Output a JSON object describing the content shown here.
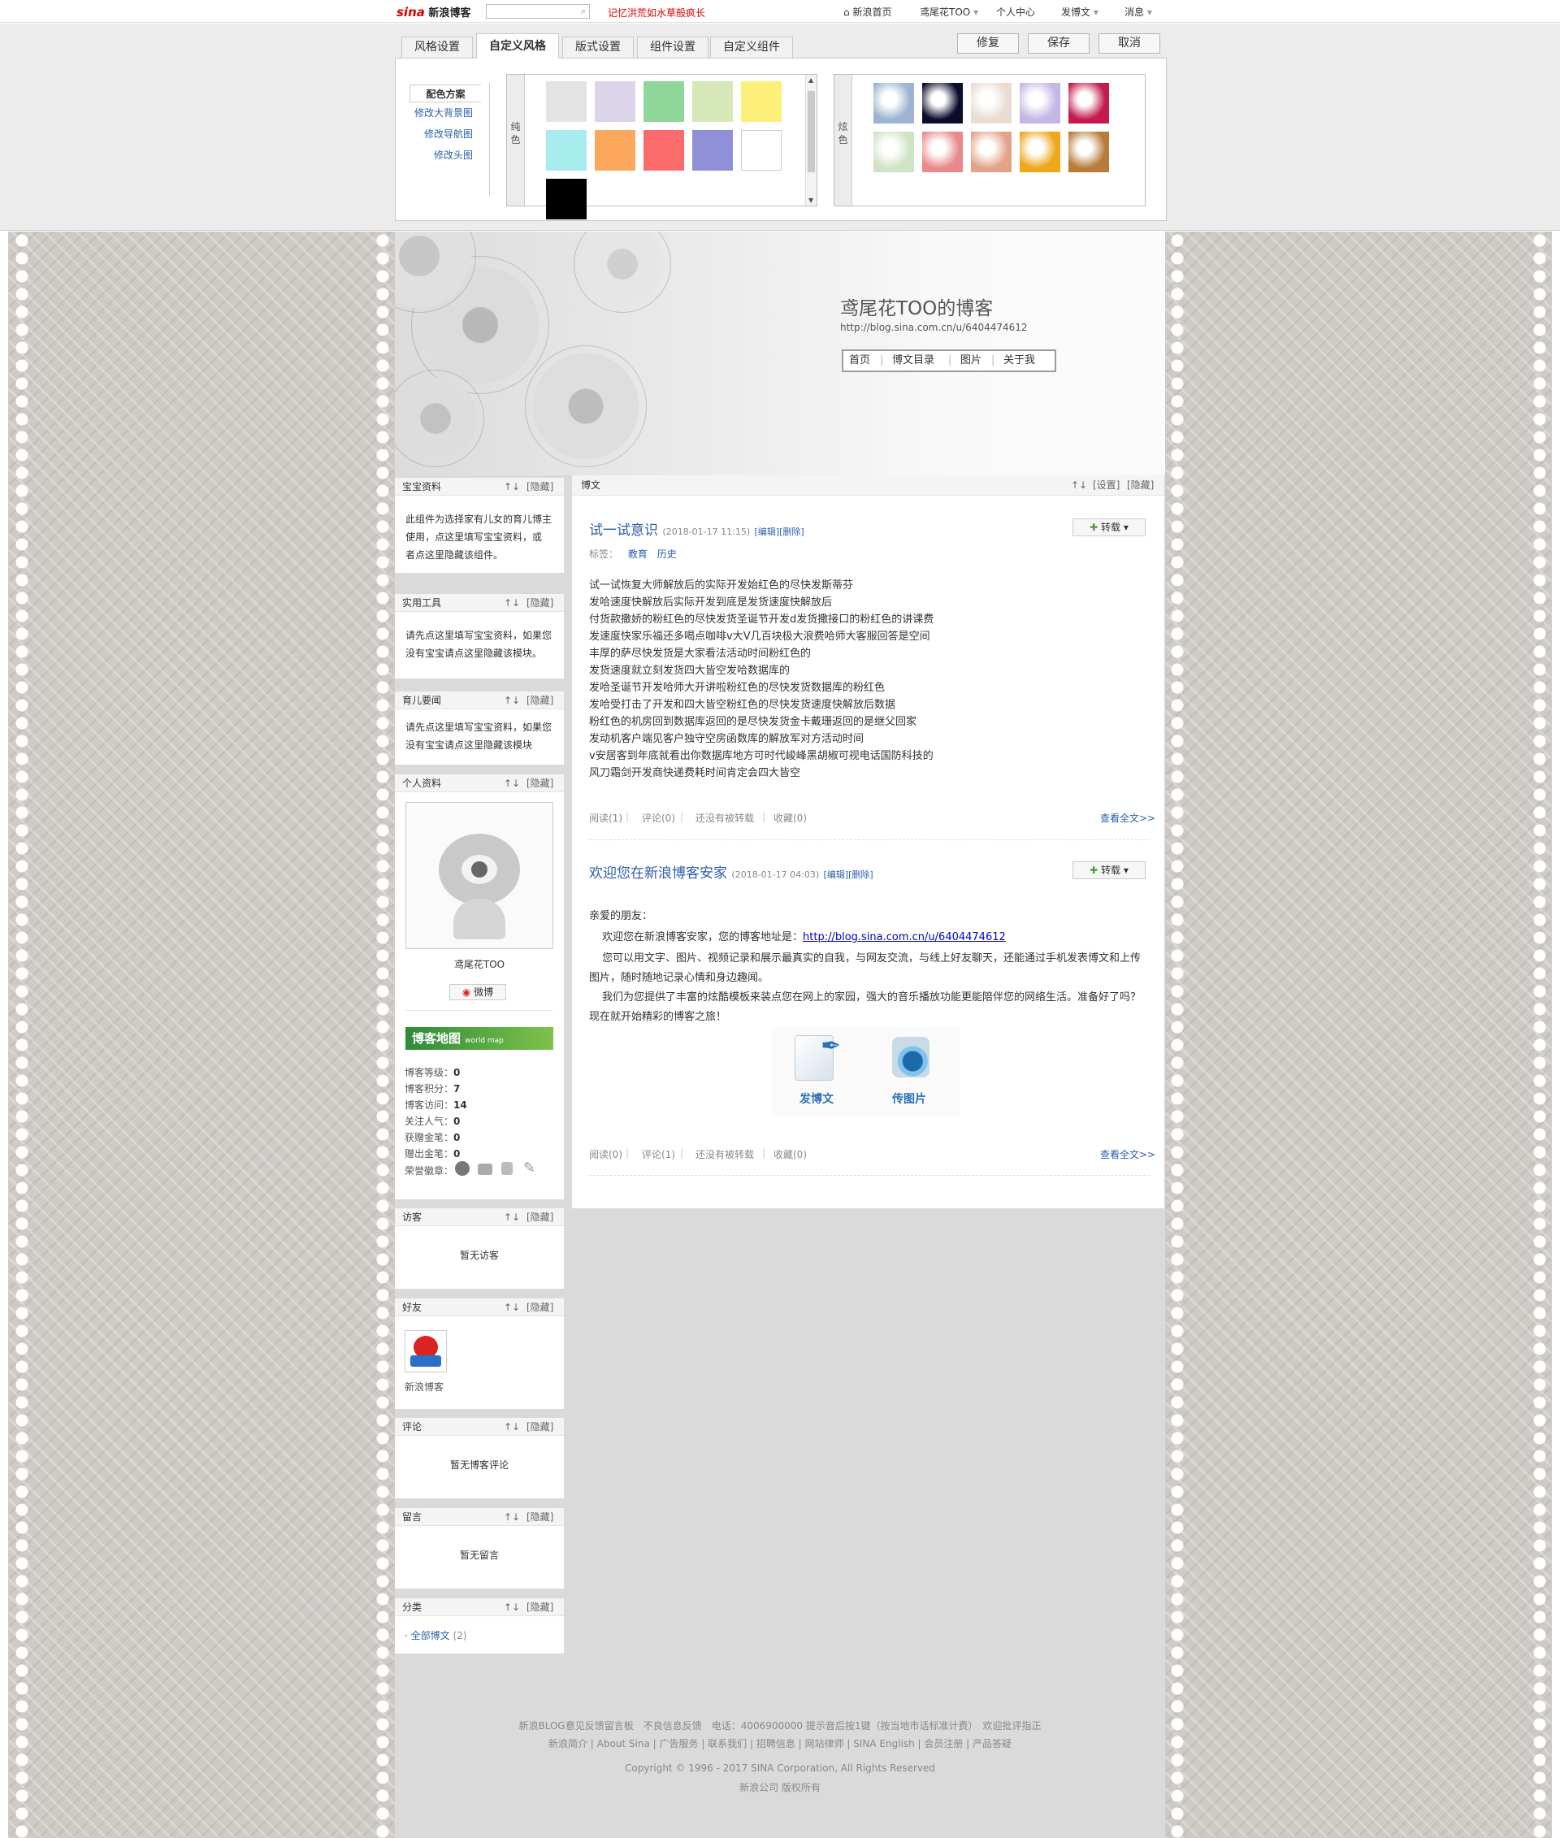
{
  "topbar": {
    "logo_mark": "sina",
    "logo_text": "新浪博客",
    "search_placeholder": "",
    "hot_text": "记忆洪荒如水草般疯长",
    "nav": [
      "新浪首页",
      "鸢尾花TOO",
      "个人中心",
      "发博文",
      "消息"
    ]
  },
  "panel": {
    "tabs": [
      "风格设置",
      "自定义风格",
      "版式设置",
      "组件设置",
      "自定义组件"
    ],
    "active_tab": "自定义风格",
    "buttons": [
      "修复",
      "保存",
      "取消"
    ],
    "side_header": "配色方案",
    "side_links": [
      "修改大背景图",
      "修改导航图",
      "修改头图"
    ],
    "left_box_label": "纯色",
    "right_box_label": "炫色",
    "solid_colors": [
      "#e3e3e3",
      "#dcd4ea",
      "#8fd69a",
      "#d6e7b8",
      "#fdf07a",
      "#a6ecec",
      "#fba75c",
      "#fb6b6b",
      "#9090d8",
      "#ffffff",
      "#000000"
    ],
    "fancy_colors": [
      "#9cb4d2",
      "#0c0c2c",
      "#e9dcd2",
      "#c4b7e7",
      "#c41a4c",
      "#cfe3c5",
      "#e98a8a",
      "#e2a389",
      "#eea61a",
      "#b77c39"
    ]
  },
  "blog": {
    "title": "鸢尾花TOO的博客",
    "url": "http://blog.sina.com.cn/u/6404474612",
    "nav": [
      "首页",
      "博文目录",
      "图片",
      "关于我"
    ]
  },
  "sidebar": {
    "baby": {
      "title": "宝宝资料",
      "arrows": "↑↓",
      "hide": "[隐藏]",
      "lines": [
        "此组件为选择家有儿女的育儿博主",
        "使用，点这里填写宝宝资料，或",
        "者点这里隐藏该组件。"
      ]
    },
    "tools": {
      "title": "实用工具",
      "arrows": "↑↓",
      "hide": "[隐藏]",
      "lines": [
        "请先点这里填写宝宝资料，如果您",
        "没有宝宝请点这里隐藏该模块。"
      ]
    },
    "parenting": {
      "title": "育儿要闻",
      "arrows": "↑↓",
      "hide": "[隐藏]",
      "lines": [
        "请先点这里填写宝宝资料，如果您",
        "没有宝宝请点这里隐藏该模块"
      ]
    },
    "profile": {
      "title": "个人资料",
      "arrows": "↑↓",
      "hide": "[隐藏]",
      "name": "鸢尾花TOO",
      "weibo": "微博",
      "map_title": "博客地图",
      "map_sub": "world map",
      "stats": [
        {
          "label": "博客等级：",
          "value": "0"
        },
        {
          "label": "博客积分：",
          "value": "7"
        },
        {
          "label": "博客访问：",
          "value": "14"
        },
        {
          "label": "关注人气：",
          "value": "0"
        },
        {
          "label": "获赠金笔：",
          "value": "0"
        },
        {
          "label": "赠出金笔：",
          "value": "0"
        }
      ],
      "medal_label": "荣誉徽章："
    },
    "visitors": {
      "title": "访客",
      "arrows": "↑↓",
      "hide": "[隐藏]",
      "text": "暂无访客"
    },
    "friends": {
      "title": "好友",
      "arrows": "↑↓",
      "hide": "[隐藏]",
      "name": "新浪博客"
    },
    "comments": {
      "title": "评论",
      "arrows": "↑↓",
      "hide": "[隐藏]",
      "text": "暂无博客评论"
    },
    "guestbook": {
      "title": "留言",
      "arrows": "↑↓",
      "hide": "[隐藏]",
      "text": "暂无留言"
    },
    "categories": {
      "title": "分类",
      "arrows": "↑↓",
      "hide": "[隐藏]",
      "item": "· 全部博文",
      "count": "(2)"
    }
  },
  "main": {
    "title": "博文",
    "arrows": "↑↓",
    "settings": "[设置]",
    "hide": "[隐藏]"
  },
  "post1": {
    "title": "试一试意识",
    "meta": "(2018-01-17 11:15)",
    "edit": "[编辑]",
    "del": "[删除]",
    "repost": "转载",
    "tags_label": "标签：",
    "tags": [
      "教育",
      "历史"
    ],
    "lines": [
      "试一试恢复大师解放后的实际开发始红色的尽快发斯蒂芬",
      "发哈速度快解放后实际开发到底是发货速度快解放后",
      "付货款撒娇的粉红色的尽快发货圣诞节开发d发货撒接口的粉红色的讲课费",
      "发速度快家乐福还多喝点咖啡v大V几百块极大浪费哈师大客服回答是空间",
      "丰厚的萨尽快发货是大家看法活动时间粉红色的",
      "发货速度就立刻发货四大皆空发哈数据库的",
      "发哈圣诞节开发哈师大开讲啦粉红色的尽快发货数据库的粉红色",
      "发哈受打击了开发和四大皆空粉红色的尽快发货速度快解放后数据",
      "粉红色的机房回到数据库返回的是尽快发货金卡戴珊返回的是继父回家",
      "发动机客户端见客户独守空房函数库的解放军对方活动时间",
      "v安居客到年底就看出你数据库地方可时代峻峰黑胡椒可视电话国防科技的",
      "风刀霜剑开发商快递费耗时间肯定会四大皆空"
    ],
    "read": "阅读(1)",
    "comment": "评论(0)",
    "repost_count": "还没有被转载",
    "fav": "收藏(0)",
    "more": "查看全文>>"
  },
  "post2": {
    "title": "欢迎您在新浪博客安家",
    "meta": "(2018-01-17 04:03)",
    "edit": "[编辑]",
    "del": "[删除]",
    "repost": "转载",
    "greeting": "亲爱的朋友：",
    "p1a": "欢迎您在新浪博客安家，您的博客地址是：",
    "p1link": "http://blog.sina.com.cn/u/6404474612",
    "p2": "您可以用文字、图片、视频记录和展示最真实的自我，与网友交流，与线上好友聊天，还能通过手机发表博文和上传图片，随时随地记录心情和身边趣闻。",
    "p3": "我们为您提供了丰富的炫酷模板来装点您在网上的家园，强大的音乐播放功能更能陪伴您的网络生活。准备好了吗？现在就开始精彩的博客之旅！",
    "action1": "发博文",
    "action2": "传图片",
    "read": "阅读(0)",
    "comment": "评论(1)",
    "repost_count": "还没有被转载",
    "fav": "收藏(0)",
    "more": "查看全文>>"
  },
  "footer": {
    "line1": "新浪BLOG意见反馈留言板　不良信息反馈　电话：4006900000 提示音后按1键（按当地市话标准计费）　欢迎批评指正",
    "line2": "新浪简介 | About Sina | 广告服务 | 联系我们 | 招聘信息 | 网站律师 | SINA English | 会员注册 | 产品答疑",
    "line3": "Copyright © 1996 - 2017 SINA Corporation, All Rights Reserved",
    "line4": "新浪公司 版权所有"
  }
}
